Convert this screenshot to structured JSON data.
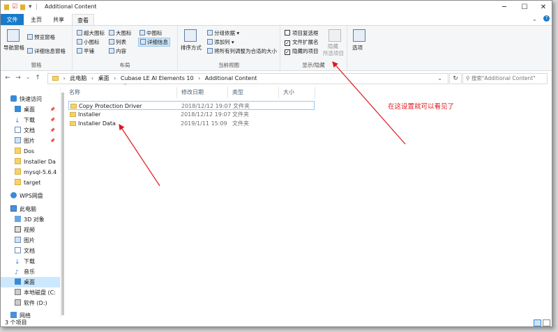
{
  "window": {
    "title": "Additional Content",
    "controls": {
      "minimize": "─",
      "maximize": "☐",
      "close": "✕"
    }
  },
  "tabs": [
    {
      "label": "文件"
    },
    {
      "label": "主页"
    },
    {
      "label": "共享"
    },
    {
      "label": "查看"
    }
  ],
  "ribbon": {
    "pane": {
      "nav_pane": "导航窗格",
      "preview": "预览窗格",
      "details": "详细信息窗格",
      "group": "窗格"
    },
    "layout": {
      "xl_icons": "超大图标",
      "l_icons": "大图标",
      "m_icons": "中图标",
      "s_icons": "小图标",
      "list": "列表",
      "details": "详细信息",
      "tiles": "平铺",
      "content": "内容",
      "group": "布局"
    },
    "view": {
      "sort": "排序方式",
      "group_by": "分组依据",
      "add_col": "添加列",
      "fit_cols": "将所有列调整为合适的大小",
      "group": "当前视图"
    },
    "showhide": {
      "item_checkbox": "项目复选框",
      "file_ext": "文件扩展名",
      "hidden_items": "隐藏的项目",
      "hide_selected_1": "隐藏",
      "hide_selected_2": "所选项目",
      "group": "显示/隐藏"
    },
    "options": "选项"
  },
  "address": {
    "parts": [
      "此电脑",
      "桌面",
      "Cubase LE AI Elements 10",
      "Additional Content"
    ],
    "search_placeholder": "搜索\"Additional Content\""
  },
  "sidebar": [
    {
      "label": "快速访问"
    },
    {
      "label": "桌面"
    },
    {
      "label": "下载"
    },
    {
      "label": "文档"
    },
    {
      "label": "图片"
    },
    {
      "label": "Dos"
    },
    {
      "label": "Installer Da"
    },
    {
      "label": "mysql-5.6.4"
    },
    {
      "label": "target"
    },
    {
      "label": "WPS网盘"
    },
    {
      "label": "此电脑"
    },
    {
      "label": "3D 对象"
    },
    {
      "label": "视频"
    },
    {
      "label": "图片"
    },
    {
      "label": "文档"
    },
    {
      "label": "下载"
    },
    {
      "label": "音乐"
    },
    {
      "label": "桌面"
    },
    {
      "label": "本地磁盘 (C:"
    },
    {
      "label": "软件 (D:)"
    },
    {
      "label": "网络"
    }
  ],
  "columns": {
    "name": "名称",
    "date": "修改日期",
    "type": "类型",
    "size": "大小"
  },
  "files": [
    {
      "name": "Copy Protection Driver",
      "date": "2018/12/12 19:07",
      "type": "文件夹"
    },
    {
      "name": "Installer",
      "date": "2018/12/12 19:07",
      "type": "文件夹"
    },
    {
      "name": "Installer Data",
      "date": "2019/1/11 15:09",
      "type": "文件夹"
    }
  ],
  "status": {
    "count": "3 个项目"
  },
  "annotation": "在这设置就可以看见了",
  "colors": {
    "accent": "#1979ca",
    "annotation": "#e0161b",
    "folder": "#f6d36a"
  }
}
